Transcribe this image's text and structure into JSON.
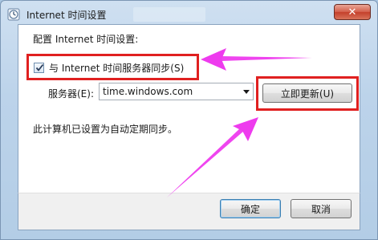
{
  "window": {
    "title": "Internet 时间设置",
    "close_glyph": "✕"
  },
  "dialog": {
    "config_label": "配置 Internet 时间设置:",
    "sync_checkbox": {
      "label": "与 Internet 时间服务器同步(S)",
      "checked": true
    },
    "server": {
      "label": "服务器(E):",
      "value": "time.windows.com"
    },
    "update_button": "立即更新(U)",
    "status_text": "此计算机已设置为自动定期同步。"
  },
  "buttons": {
    "ok": "确定",
    "cancel": "取消"
  },
  "colors": {
    "highlight": "#e02020",
    "arrow": "#ee3bee",
    "title_accent": "#c4402b"
  },
  "icons": [
    "clock-icon",
    "close-icon",
    "checkmark-icon",
    "chevron-down-icon",
    "arrow-annotation"
  ]
}
